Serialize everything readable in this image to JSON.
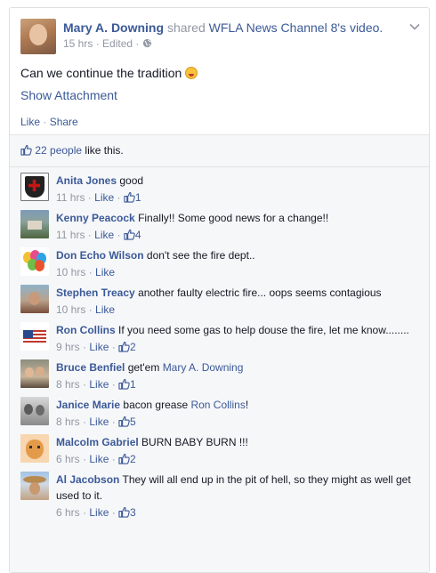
{
  "post": {
    "author": "Mary A. Downing",
    "action": "shared",
    "source": "WFLA News Channel 8",
    "suffix": "'s video.",
    "time": "15 hrs",
    "edited": "Edited",
    "message": "Can we continue the tradition",
    "show_attachment": "Show Attachment",
    "like": "Like",
    "share": "Share"
  },
  "likes": {
    "count_text": "22 people",
    "suffix": " like this."
  },
  "comments": [
    {
      "name": "Anita Jones",
      "text": "good",
      "time": "11 hrs",
      "like": "Like",
      "likes": "1",
      "avatar": "templar-cross"
    },
    {
      "name": "Kenny Peacock",
      "text": "Finally!! Some good news for a change!!",
      "time": "11 hrs",
      "like": "Like",
      "likes": "4",
      "avatar": "house-photo"
    },
    {
      "name": "Don Echo Wilson",
      "text": "don't see the fire dept..",
      "time": "10 hrs",
      "like": "Like",
      "likes": "",
      "avatar": "balloons"
    },
    {
      "name": "Stephen Treacy",
      "text": "another faulty electric fire... oops seems contagious",
      "time": "10 hrs",
      "like": "Like",
      "likes": "",
      "avatar": "man-photo"
    },
    {
      "name": "Ron Collins",
      "text": "If you need some gas to help douse the fire, let me know........",
      "time": "9 hrs",
      "like": "Like",
      "likes": "2",
      "avatar": "god-bless-flag"
    },
    {
      "name": "Bruce Benfiel",
      "text": "get'em ",
      "tag": "Mary A. Downing",
      "after": "",
      "time": "8 hrs",
      "like": "Like",
      "likes": "1",
      "avatar": "couple-photo"
    },
    {
      "name": "Janice Marie",
      "text": "bacon grease ",
      "tag": "Ron Collins",
      "after": "!",
      "time": "8 hrs",
      "like": "Like",
      "likes": "5",
      "avatar": "bw-photo"
    },
    {
      "name": "Malcolm Gabriel",
      "text": "BURN BABY BURN !!!",
      "time": "6 hrs",
      "like": "Like",
      "likes": "2",
      "avatar": "cat-photo"
    },
    {
      "name": "Al Jacobson",
      "text": "They will all end up in the pit of hell, so they might as well get used to it.",
      "time": "6 hrs",
      "like": "Like",
      "likes": "3",
      "avatar": "cowboy-hat-photo"
    }
  ]
}
